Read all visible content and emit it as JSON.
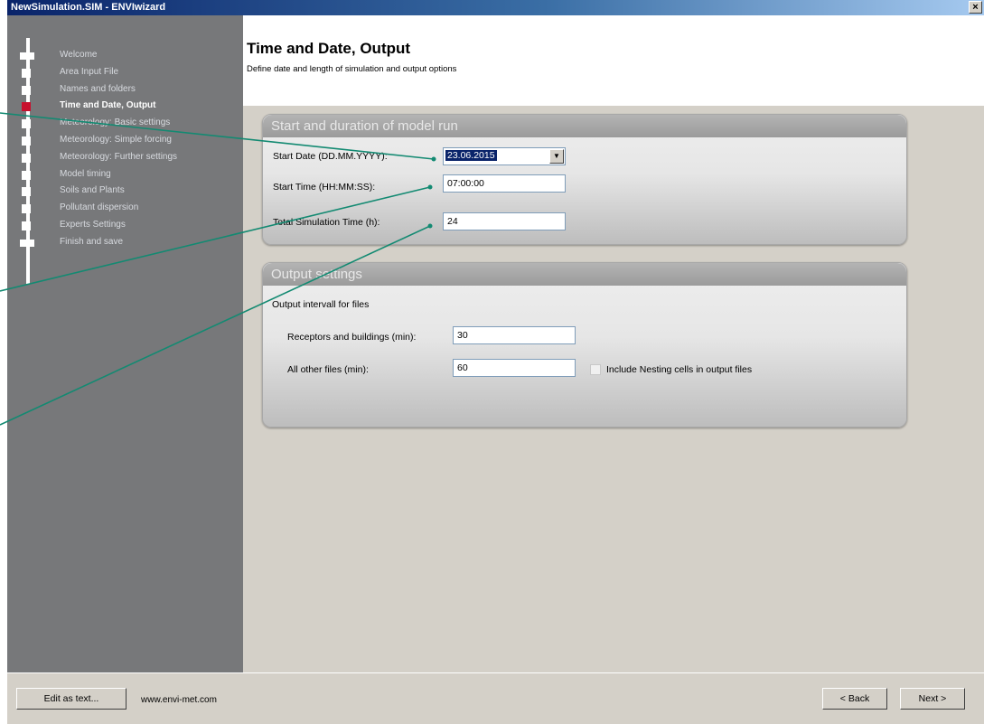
{
  "window": {
    "title": "NewSimulation.SIM - ENVIwizard",
    "close_glyph": "×"
  },
  "sidebar": {
    "steps": [
      {
        "label": "Welcome",
        "current": false
      },
      {
        "label": "Area Input File",
        "current": false
      },
      {
        "label": "Names and folders",
        "current": false
      },
      {
        "label": "Time and Date, Output",
        "current": true
      },
      {
        "label": "Meteorology: Basic settings",
        "current": false
      },
      {
        "label": "Meteorology: Simple forcing",
        "current": false
      },
      {
        "label": "Meteorology: Further settings",
        "current": false
      },
      {
        "label": "Model timing",
        "current": false
      },
      {
        "label": "Soils and Plants",
        "current": false
      },
      {
        "label": "Pollutant dispersion",
        "current": false
      },
      {
        "label": "Experts Settings",
        "current": false
      },
      {
        "label": "Finish and save",
        "current": false
      }
    ]
  },
  "header": {
    "title": "Time and Date, Output",
    "subtitle": "Define date and length of simulation and output options"
  },
  "start_panel": {
    "title": "Start and duration of model run",
    "start_date_label": "Start Date (DD.MM.YYYY):",
    "start_date_value": "23.06.2015",
    "start_time_label": "Start Time (HH:MM:SS):",
    "start_time_value": "07:00:00",
    "total_time_label": "Total Simulation Time (h):",
    "total_time_value": "24"
  },
  "output_panel": {
    "title": "Output settings",
    "interval_label": "Output intervall for files",
    "receptors_label": "Receptors  and buildings (min):",
    "receptors_value": "30",
    "other_label": "All other files (min):",
    "other_value": "60",
    "nesting_label": "Include Nesting cells in output files",
    "nesting_checked": false
  },
  "statusbar": {
    "edit_text_label": "Edit as text...",
    "url": "www.envi-met.com",
    "back_label": "< Back",
    "next_label": "Next >"
  },
  "colors": {
    "sidebar": "#77787a",
    "current_step": "#c8102e",
    "annotation_line": "#138a72",
    "selection": "#0a246a"
  }
}
